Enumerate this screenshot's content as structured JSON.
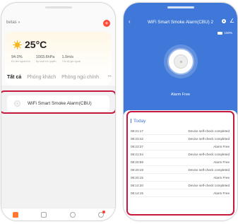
{
  "home": {
    "title": "betas",
    "weather": {
      "temperature": "25°C",
      "stats": [
        {
          "value": "94.0%",
          "label": "Độ ẩm ngoài trời"
        },
        {
          "value": "1003.6hPa",
          "label": "Áp suất khí quyển"
        },
        {
          "value": "1.0m/s",
          "label": "Tốc độ gió ngoài"
        }
      ]
    },
    "tabs": [
      "Tất cả",
      "Phòng khách",
      "Phòng ngủ chính"
    ],
    "more": "···",
    "device": {
      "name": "WiFi Smart Smoke Alarm(CBU)"
    },
    "tabbar_icons": [
      "home-icon",
      "checkbox-icon",
      "circle-icon",
      "profile-icon"
    ]
  },
  "detail": {
    "back": "‹",
    "title": "WiFi Smart Smoke Alarm(CBU) 2",
    "edit": "∠",
    "battery": "100%",
    "status": "Alarm Free",
    "section": "Today",
    "events": [
      {
        "time": "08:21:17",
        "text": "Device self-check completed"
      },
      {
        "time": "08:23:42",
        "text": "Device self-check completed"
      },
      {
        "time": "08:23:37",
        "text": "Alarm Free"
      },
      {
        "time": "08:21:04",
        "text": "Device self-check completed"
      },
      {
        "time": "08:20:59",
        "text": "Alarm Free"
      },
      {
        "time": "08:20:19",
        "text": "Device self-check completed"
      },
      {
        "time": "08:20:15",
        "text": "Alarm Free"
      },
      {
        "time": "08:14:20",
        "text": "Device self-check completed"
      },
      {
        "time": "08:14:15",
        "text": "Alarm Free"
      }
    ]
  },
  "colors": {
    "brand_blue": "#3f78d8",
    "highlight": "#c8173d",
    "add": "#ff4a3a",
    "sun": "#f7b51e"
  }
}
